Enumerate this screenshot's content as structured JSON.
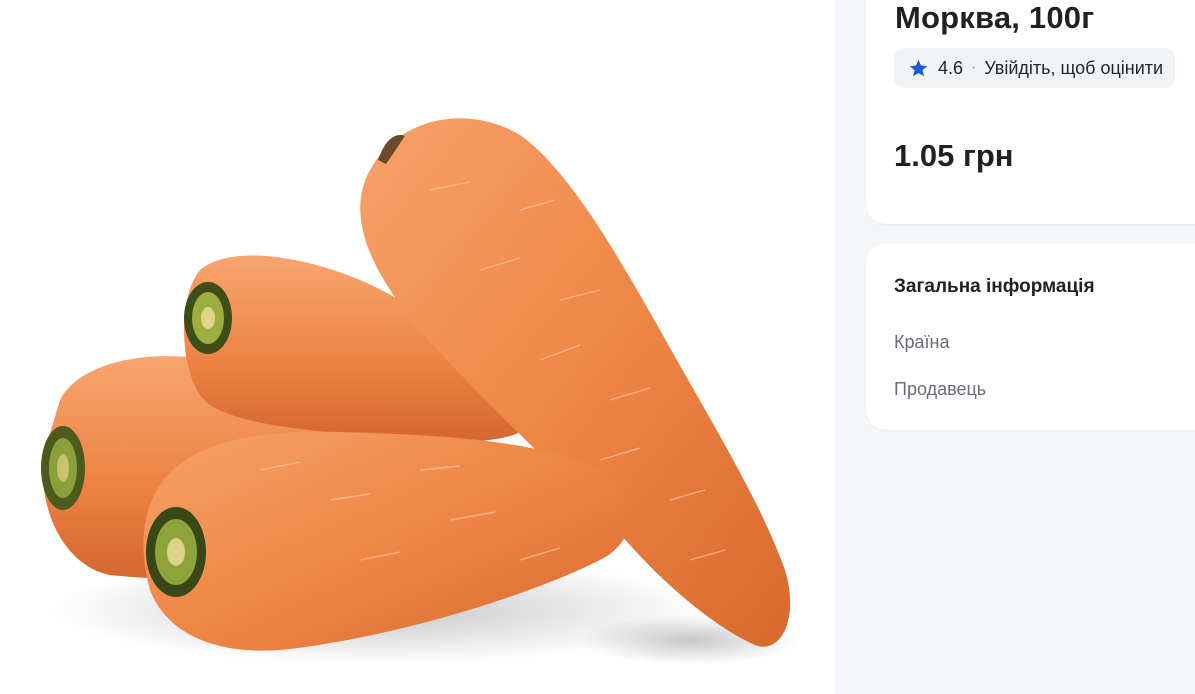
{
  "product": {
    "title": "Морква, 100г",
    "rating": "4.6",
    "rating_separator": "·",
    "rating_login": "Увійдіть, щоб оцінити",
    "price": "1.05 грн"
  },
  "info": {
    "title": "Загальна інформація",
    "rows": [
      "Країна",
      "Продавець"
    ]
  },
  "icons": {
    "star": "star-icon",
    "image": "carrots-photo"
  },
  "colors": {
    "page_bg": "#f4f6fa",
    "card_bg": "#ffffff",
    "star": "#1e5ad6",
    "carrot": "#f08a4b",
    "text": "#1f2125",
    "muted": "#676c75"
  }
}
